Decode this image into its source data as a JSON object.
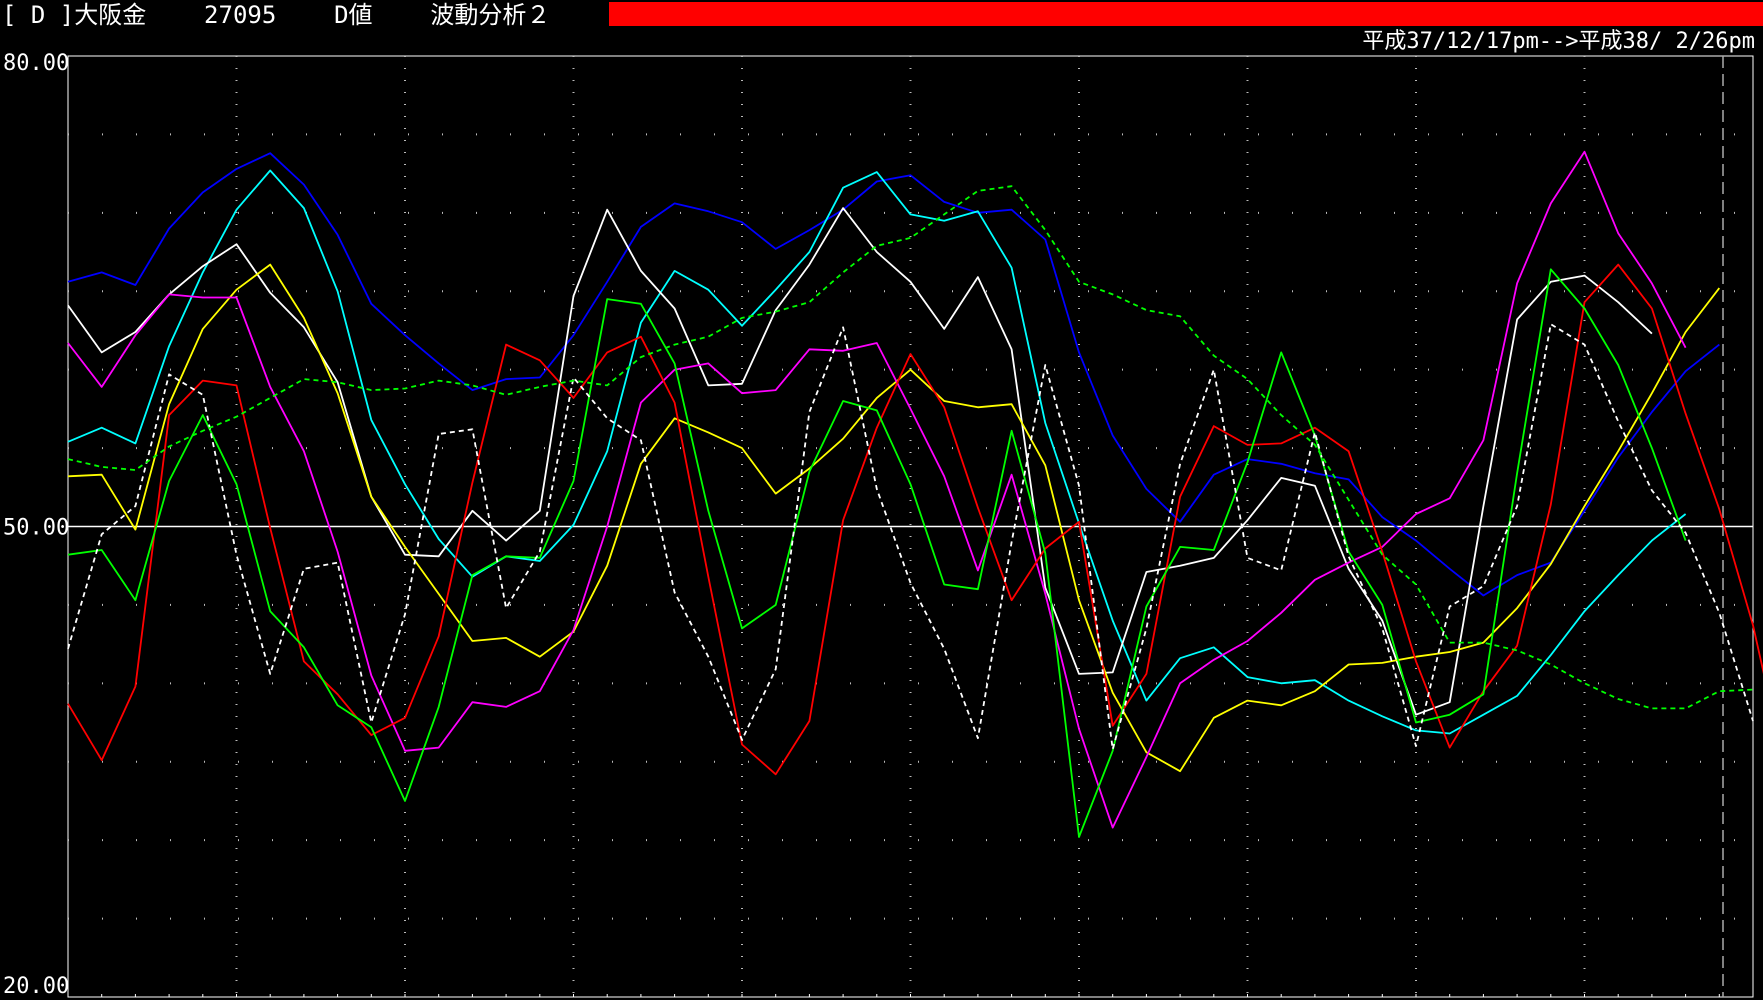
{
  "header": {
    "tag": "[ D ]",
    "name": "大阪金",
    "code": "27095",
    "indicator": "D値",
    "analysis": "波動分析２",
    "bar_color": "#ff0000",
    "date_range": "平成37/12/17pm-->平成38/ 2/26pm"
  },
  "chart_data": {
    "type": "line",
    "title": "",
    "xlabel": "",
    "ylabel": "",
    "ylim": [
      20,
      80
    ],
    "yticks": [
      {
        "value": 80,
        "label": "80.00"
      },
      {
        "value": 50,
        "label": "50.00"
      },
      {
        "value": 20,
        "label": "20.00"
      }
    ],
    "grid": true,
    "hline": 50,
    "n_points": 50,
    "series": [
      {
        "color": "#0000ff",
        "dash": false,
        "values": [
          65.6,
          66.2,
          65.4,
          69.0,
          71.3,
          72.8,
          73.8,
          71.8,
          68.6,
          64.2,
          62.2,
          60.4,
          58.7,
          59.4,
          59.5,
          62.2,
          65.6,
          69.1,
          70.6,
          70.1,
          69.4,
          67.7,
          68.9,
          70.2,
          72.0,
          72.4,
          70.7,
          70.0,
          70.2,
          68.3,
          61.1,
          55.8,
          52.4,
          50.3,
          53.3,
          54.3,
          54.0,
          53.4,
          53.0,
          50.6,
          49.1,
          47.3,
          45.6,
          46.9,
          47.7,
          51.0,
          54.4,
          57.3,
          59.9,
          61.6
        ]
      },
      {
        "color": "#00ffff",
        "dash": false,
        "values": [
          55.4,
          56.3,
          55.3,
          61.5,
          66.2,
          70.2,
          72.7,
          70.3,
          65.0,
          56.8,
          52.7,
          49.2,
          46.8,
          48.1,
          47.8,
          50.1,
          54.8,
          63.0,
          66.3,
          65.1,
          62.8,
          65.1,
          67.5,
          71.6,
          72.6,
          69.9,
          69.5,
          70.1,
          66.5,
          56.6,
          50.2,
          44.0,
          38.9,
          41.6,
          42.3,
          40.4,
          40.0,
          40.2,
          38.9,
          37.9,
          37.0,
          36.8,
          38.0,
          39.2,
          41.8,
          44.6,
          46.9,
          49.1,
          50.8
        ]
      },
      {
        "color": "#ffffff",
        "dash": false,
        "values": [
          64.1,
          61.1,
          62.4,
          64.8,
          66.6,
          68.0,
          64.9,
          62.7,
          59.2,
          51.9,
          48.2,
          48.1,
          51.0,
          49.1,
          51.0,
          64.7,
          70.2,
          66.3,
          63.9,
          59.0,
          59.1,
          63.8,
          66.7,
          70.3,
          67.5,
          65.6,
          62.6,
          65.9,
          61.3,
          46.1,
          40.6,
          40.7,
          47.1,
          47.5,
          48.0,
          50.4,
          53.1,
          52.6,
          47.3,
          44.0,
          38.0,
          38.8,
          51.3,
          63.2,
          65.6,
          66.0,
          64.3,
          62.3
        ]
      },
      {
        "color": "#ffff00",
        "dash": false,
        "values": [
          53.2,
          53.3,
          49.8,
          57.8,
          62.6,
          65.1,
          66.7,
          63.3,
          58.5,
          51.9,
          48.7,
          45.7,
          42.7,
          42.9,
          41.7,
          43.3,
          47.5,
          54.0,
          56.9,
          56.0,
          55.0,
          52.1,
          53.7,
          55.6,
          58.2,
          60.0,
          58.0,
          57.6,
          57.8,
          53.9,
          45.3,
          39.4,
          35.6,
          34.4,
          37.8,
          38.9,
          38.6,
          39.5,
          41.2,
          41.3,
          41.7,
          42.0,
          42.6,
          44.8,
          47.6,
          51.3,
          54.8,
          58.5,
          62.4,
          65.2
        ]
      },
      {
        "color": "#ff00ff",
        "dash": false,
        "values": [
          61.7,
          58.9,
          62.2,
          64.8,
          64.6,
          64.6,
          58.9,
          54.8,
          48.4,
          40.5,
          35.7,
          35.9,
          38.8,
          38.5,
          39.5,
          43.4,
          50.0,
          57.9,
          60.0,
          60.4,
          58.5,
          58.7,
          61.3,
          61.2,
          61.7,
          57.5,
          53.2,
          47.2,
          53.3,
          45.7,
          37.1,
          30.8,
          35.3,
          40.0,
          41.5,
          42.7,
          44.5,
          46.6,
          47.7,
          48.7,
          50.8,
          51.8,
          55.5,
          65.5,
          70.6,
          73.9,
          68.7,
          65.5,
          61.4
        ]
      },
      {
        "color": "#ff0000",
        "dash": false,
        "values": [
          38.7,
          35.1,
          39.8,
          57.1,
          59.3,
          59.0,
          49.9,
          41.4,
          39.3,
          36.7,
          37.8,
          43.0,
          52.8,
          61.6,
          60.6,
          58.2,
          61.1,
          62.1,
          57.9,
          46.8,
          36.1,
          34.2,
          37.6,
          50.4,
          56.3,
          61.0,
          57.6,
          51.2,
          45.3,
          48.6,
          50.3,
          37.3,
          40.6,
          51.9,
          56.4,
          55.2,
          55.3,
          56.3,
          54.8,
          48.4,
          41.4,
          35.9,
          39.5,
          42.4,
          51.4,
          64.3,
          66.7,
          63.9,
          57.2,
          51.1,
          43.7,
          34.1
        ]
      },
      {
        "color": "#00ff00",
        "dash": false,
        "values": [
          48.2,
          48.5,
          45.3,
          52.9,
          57.1,
          52.7,
          44.6,
          42.3,
          38.6,
          37.2,
          32.5,
          38.5,
          46.9,
          48.1,
          48.0,
          52.9,
          64.5,
          64.2,
          60.4,
          51.0,
          43.5,
          45.0,
          53.5,
          58.0,
          57.4,
          52.7,
          46.3,
          46.0,
          56.1,
          48.3,
          30.2,
          35.7,
          44.9,
          48.7,
          48.5,
          54.1,
          61.1,
          55.8,
          48.4,
          45.0,
          37.5,
          38.0,
          39.3,
          53.4,
          66.4,
          63.9,
          60.3,
          55.0,
          49.1
        ]
      },
      {
        "color": "#ffffff",
        "dash": true,
        "values": [
          42.2,
          49.5,
          51.3,
          59.7,
          58.4,
          48.2,
          40.6,
          47.3,
          47.7,
          37.5,
          44.4,
          55.9,
          56.2,
          44.8,
          48.4,
          59.5,
          56.9,
          55.5,
          45.8,
          41.7,
          36.4,
          40.9,
          57.3,
          62.7,
          52.4,
          46.4,
          42.2,
          36.5,
          49.0,
          60.3,
          52.6,
          35.8,
          43.5,
          54.0,
          60.0,
          48.0,
          47.2,
          56.0,
          48.1,
          43.5,
          36.0,
          44.9,
          46.2,
          51.3,
          62.9,
          61.6,
          56.7,
          52.3,
          49.6,
          44.5,
          37.6
        ]
      },
      {
        "color": "#00ff00",
        "dash": true,
        "values": [
          54.3,
          53.8,
          53.6,
          55.1,
          56.1,
          57.0,
          58.2,
          59.4,
          59.2,
          58.7,
          58.8,
          59.3,
          59.0,
          58.4,
          58.9,
          59.3,
          59.0,
          60.8,
          61.6,
          62.1,
          63.3,
          63.7,
          64.3,
          66.2,
          67.9,
          68.4,
          69.9,
          71.4,
          71.7,
          68.9,
          65.6,
          64.8,
          63.8,
          63.4,
          60.9,
          59.4,
          57.1,
          55.2,
          51.7,
          48.2,
          46.3,
          42.6,
          42.6,
          42.1,
          41.2,
          40.0,
          39.0,
          38.4,
          38.4,
          39.5,
          39.6
        ]
      }
    ]
  }
}
